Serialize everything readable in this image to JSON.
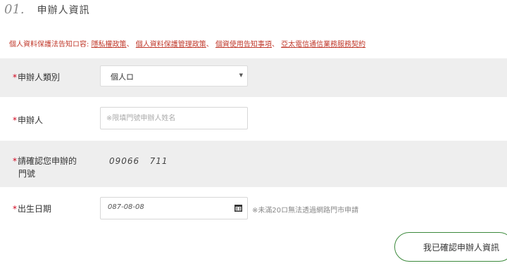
{
  "section": {
    "number": "01.",
    "title": "申辦人資訊"
  },
  "notice": {
    "prefix": "個人資料保護法告知ロ容:",
    "links": [
      "隱私權政策",
      "個人資料保護管理政策",
      "個資使用告知事項",
      "亞太電信通信業務服務契約"
    ],
    "separator": "、"
  },
  "form": {
    "applicant_type": {
      "required_mark": "*",
      "label": "申辦人類別",
      "value": "個人ロ",
      "arrow": "▼"
    },
    "applicant": {
      "required_mark": "*",
      "label": "申辦人",
      "placeholder": "※限填門號申辦人姓名",
      "value": ""
    },
    "phone": {
      "required_mark": "*",
      "label_line1": "請確認您申辦的",
      "label_line2": "門號",
      "value": "09066   711"
    },
    "birthdate": {
      "required_mark": "*",
      "label": "出生日期",
      "value": "087-08-08",
      "note": "※未滿20ロ無法透過網路門市申請"
    }
  },
  "confirm_button": {
    "label": "我已確認申辦人資訊"
  },
  "colors": {
    "required": "#d0021b",
    "notice_link": "#c0392b",
    "row_shade": "#eeeeee",
    "button_border": "#3c8a3c"
  }
}
